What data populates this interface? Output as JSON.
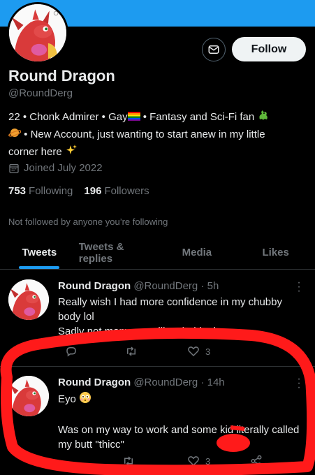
{
  "profile": {
    "display_name": "Round Dragon",
    "handle": "@RoundDerg",
    "bio_line1": "22 • Chonk Admirer • Gay",
    "bio_line1_tail": " • Fantasy and Sci-Fi fan ",
    "bio_line2": " • New Account, just wanting to start anew in my little",
    "bio_line3": "corner here ",
    "joined": "Joined July 2022",
    "following_count": "753",
    "following_label": "Following",
    "followers_count": "196",
    "followers_label": "Followers",
    "not_followed_text": "Not followed by anyone you’re following"
  },
  "header": {
    "follow_label": "Follow"
  },
  "tabs": [
    {
      "label": "Tweets",
      "active": true
    },
    {
      "label": "Tweets & replies",
      "active": false
    },
    {
      "label": "Media",
      "active": false
    },
    {
      "label": "Likes",
      "active": false
    }
  ],
  "tweets": [
    {
      "name": "Round Dragon",
      "handle": "@RoundDerg · 5h",
      "line1": "Really wish I had more confidence in my chubby",
      "line2": "body lol",
      "line3": "Sadly not many guys like chubby boys",
      "likes": "3"
    },
    {
      "name": "Round Dragon",
      "handle": "@RoundDerg · 14h",
      "line1": "Eyo ",
      "line2": "Was on my way to work and some kid literally called",
      "line3": "my butt \"thicc\"",
      "likes": "3"
    }
  ],
  "colors": {
    "accent": "#1d9bf0",
    "background": "#000000",
    "muted": "#71767b",
    "highlight": "#ff1a1a"
  },
  "icons": [
    "envelope-icon",
    "calendar-icon",
    "more-icon",
    "reply-icon",
    "retweet-icon",
    "heart-icon",
    "share-icon",
    "rainbow-flag-icon",
    "dragon-emoji-icon",
    "planet-emoji-icon",
    "sparkles-emoji-icon",
    "flushed-emoji-icon"
  ]
}
